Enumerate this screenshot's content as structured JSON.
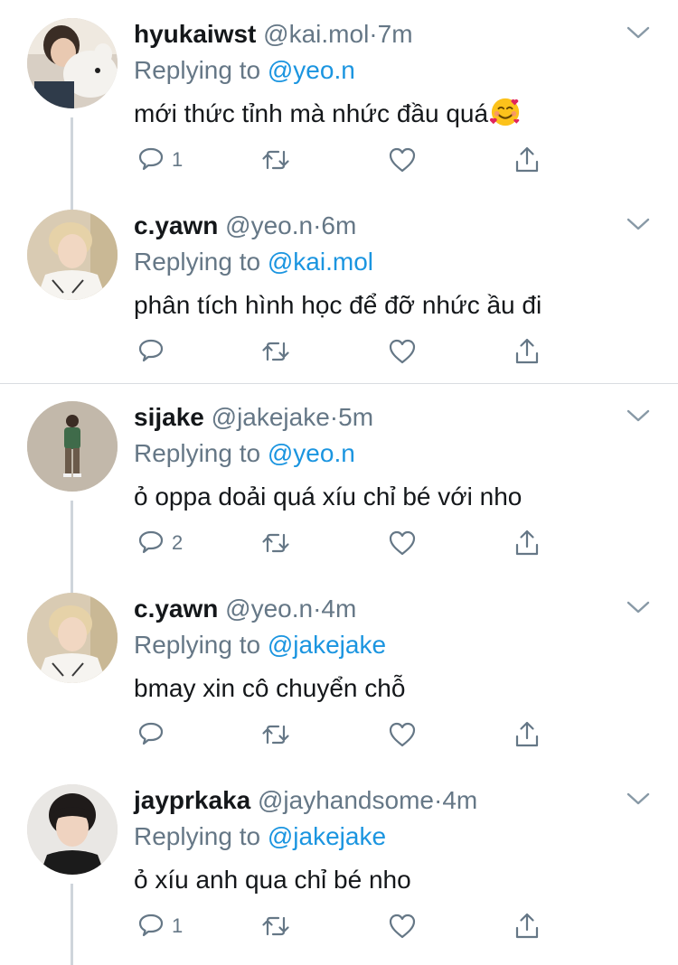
{
  "tweets": [
    {
      "name": "hyukaiwst",
      "handle": "@kai.mol",
      "separator": "·",
      "time": "7m",
      "replying_label": "Replying to",
      "replying_to": "@yeo.n",
      "text": "mới thức tỉnh mà nhức đầu quá",
      "emoji": "smiling-face-with-hearts-emoji",
      "reply_count": "1",
      "avatar": "person-holding-white-plush-bear"
    },
    {
      "name": "c.yawn",
      "handle": "@yeo.n",
      "separator": "·",
      "time": "6m",
      "replying_label": "Replying to",
      "replying_to": "@kai.mol",
      "text": "phân tích hình học để đỡ nhức ầu đi",
      "reply_count": "",
      "avatar": "blond-person-selfie"
    },
    {
      "name": "sijake",
      "handle": "@jakejake",
      "separator": "·",
      "time": "5m",
      "replying_label": "Replying to",
      "replying_to": "@yeo.n",
      "text": "ỏ oppa doải quá xíu chỉ bé với nho",
      "reply_count": "2",
      "avatar": "person-standing-on-pavement"
    },
    {
      "name": "c.yawn",
      "handle": "@yeo.n",
      "separator": "·",
      "time": "4m",
      "replying_label": "Replying to",
      "replying_to": "@jakejake",
      "text": "bmay xin cô chuyển chỗ",
      "reply_count": "",
      "avatar": "blond-person-selfie"
    },
    {
      "name": "jayprkaka",
      "handle": "@jayhandsome",
      "separator": "·",
      "time": "4m",
      "replying_label": "Replying to",
      "replying_to": "@jakejake",
      "text": "ỏ xíu anh qua chỉ bé nho",
      "reply_count": "1",
      "avatar": "dark-haired-person-portrait"
    }
  ],
  "icons": {
    "reply": "reply-icon",
    "retweet": "retweet-icon",
    "like": "heart-icon",
    "share": "share-icon",
    "menu": "chevron-down-icon"
  },
  "colors": {
    "link": "#1b95e0",
    "muted": "#657786",
    "text": "#14171a",
    "divider": "#d9dde1",
    "thread_line": "#cfd5db"
  }
}
